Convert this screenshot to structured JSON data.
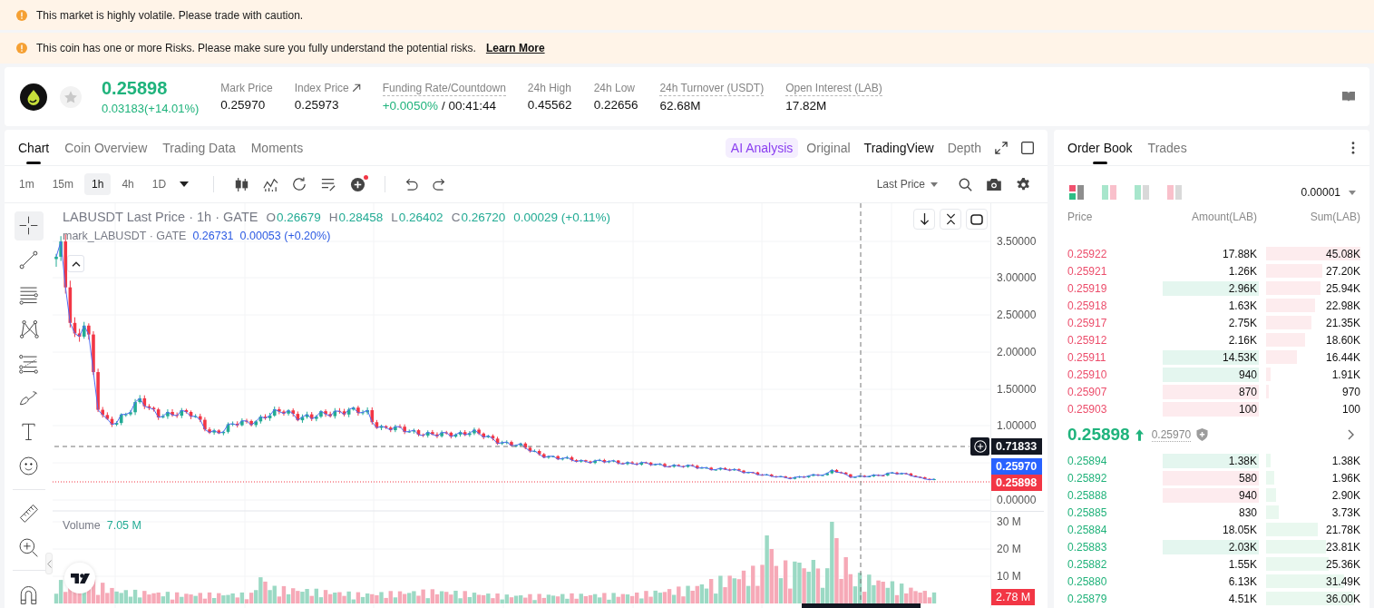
{
  "alerts": [
    {
      "text": "This market is highly volatile. Please trade with caution."
    },
    {
      "text": "This coin has one or more Risks. Please make sure you fully understand the potential risks.",
      "link": "Learn More"
    }
  ],
  "ticker": {
    "price": "0.25898",
    "change": "0.03183(+14.01%)",
    "favorite": false,
    "stats": [
      {
        "kind": "plain",
        "label": "Mark Price",
        "value": "0.25970",
        "dotted": false
      },
      {
        "kind": "link",
        "label": "Index Price",
        "value": "0.25973",
        "dotted": false
      },
      {
        "kind": "funding",
        "label": "Funding Rate/Countdown",
        "value": "+0.0050%",
        "countdown": "/ 00:41:44",
        "dotted": true
      },
      {
        "kind": "plain",
        "label": "24h High",
        "value": "0.45562",
        "dotted": false
      },
      {
        "kind": "plain",
        "label": "24h Low",
        "value": "0.22656",
        "dotted": false
      },
      {
        "kind": "plain",
        "label": "24h Turnover (USDT)",
        "value": "62.68M",
        "dotted": true
      },
      {
        "kind": "plain",
        "label": "Open Interest (LAB)",
        "value": "17.82M",
        "dotted": true
      }
    ]
  },
  "chart_panel": {
    "tabs": [
      {
        "label": "Chart",
        "selected": true
      },
      {
        "label": "Coin Overview",
        "selected": false
      },
      {
        "label": "Trading Data",
        "selected": false
      },
      {
        "label": "Moments",
        "selected": false
      }
    ],
    "ai_button": "AI Analysis",
    "views": [
      {
        "label": "Original",
        "selected": false
      },
      {
        "label": "TradingView",
        "selected": true
      },
      {
        "label": "Depth",
        "selected": false
      }
    ],
    "intervals": [
      {
        "label": "1m",
        "selected": false
      },
      {
        "label": "15m",
        "selected": false
      },
      {
        "label": "1h",
        "selected": true
      },
      {
        "label": "4h",
        "selected": false
      },
      {
        "label": "1D",
        "selected": false
      }
    ],
    "price_source": "Last Price",
    "tools": [
      {
        "selected": true
      },
      {
        "selected": false
      },
      {
        "selected": false
      },
      {
        "selected": false
      },
      {
        "selected": false
      },
      {
        "selected": false
      },
      {
        "selected": false
      },
      {
        "selected": false
      },
      {
        "selected": false
      },
      {
        "selected": false
      },
      {
        "selected": false
      }
    ],
    "legend": {
      "symbol": "LABUSDT Last Price · 1h · GATE",
      "ohlc": [
        {
          "key": "O",
          "value": "0.26679"
        },
        {
          "key": "H",
          "value": "0.28458"
        },
        {
          "key": "L",
          "value": "0.26402"
        },
        {
          "key": "C",
          "value": "0.26720"
        }
      ],
      "change": "0.00029 (+0.11%)",
      "mark_symbol": "mark_LABUSDT · GATE",
      "mark_price": "0.26731",
      "mark_change": "0.00053 (+0.20%)"
    },
    "price_axis": [
      "3.50000",
      "3.00000",
      "2.50000",
      "2.00000",
      "1.50000",
      "1.00000",
      "0.00000"
    ],
    "price_tags": [
      {
        "kind": "crosshair",
        "text": "0.71833"
      },
      {
        "kind": "mark",
        "text": "0.25970"
      },
      {
        "kind": "last",
        "text": "0.25898"
      }
    ],
    "volume": {
      "label": "Volume",
      "value": "7.05 M",
      "axis": [
        "30 M",
        "20 M",
        "10 M"
      ],
      "tag": "2.78 M"
    }
  },
  "order_book": {
    "tabs": [
      {
        "label": "Order Book",
        "selected": true
      },
      {
        "label": "Trades",
        "selected": false
      }
    ],
    "layouts": [
      {
        "selected": true
      },
      {
        "selected": false
      },
      {
        "selected": false
      },
      {
        "selected": false
      }
    ],
    "precision": "0.00001",
    "columns": [
      "Price",
      "Amount(LAB)",
      "Sum(LAB)"
    ],
    "asks": [
      {
        "price": "0.25922",
        "amount": "17.88K",
        "sum": "45.08K",
        "level": 1.0
      },
      {
        "price": "0.25921",
        "amount": "1.26K",
        "sum": "27.20K",
        "level": 0.6
      },
      {
        "price": "0.25919",
        "amount": "2.96K",
        "sum": "25.94K",
        "color": "#e4f6ef",
        "level": 0.58
      },
      {
        "price": "0.25918",
        "amount": "1.63K",
        "sum": "22.98K",
        "level": 0.52
      },
      {
        "price": "0.25917",
        "amount": "2.75K",
        "sum": "21.35K",
        "level": 0.48
      },
      {
        "price": "0.25912",
        "amount": "2.16K",
        "sum": "18.60K",
        "level": 0.41
      },
      {
        "price": "0.25911",
        "amount": "14.53K",
        "sum": "16.44K",
        "color": "#e4f6ef",
        "level": 0.33
      },
      {
        "price": "0.25910",
        "amount": "940",
        "sum": "1.91K",
        "color": "#e4f6ef",
        "level": 0.05
      },
      {
        "price": "0.25907",
        "amount": "870",
        "sum": "970",
        "color": "#fdebee",
        "level": 0.03
      },
      {
        "price": "0.25903",
        "amount": "100",
        "sum": "100",
        "color": "#fdebee"
      }
    ],
    "last_price": "0.25898",
    "rising": true,
    "mark_price": "0.25970",
    "bids": [
      {
        "price": "0.25894",
        "amount": "1.38K",
        "sum": "1.38K",
        "color": "#e4f6ef",
        "level": 0.05
      },
      {
        "price": "0.25892",
        "amount": "580",
        "sum": "1.96K",
        "color": "#fdebee",
        "level": 0.09
      },
      {
        "price": "0.25888",
        "amount": "940",
        "sum": "2.90K",
        "color": "#fdebee",
        "level": 0.11
      },
      {
        "price": "0.25885",
        "amount": "830",
        "sum": "3.73K",
        "level": 0.13
      },
      {
        "price": "0.25884",
        "amount": "18.05K",
        "sum": "21.78K",
        "level": 0.55
      },
      {
        "price": "0.25883",
        "amount": "2.03K",
        "sum": "23.81K",
        "color": "#e4f6ef",
        "level": 0.63
      },
      {
        "price": "0.25882",
        "amount": "1.55K",
        "sum": "25.36K",
        "level": 0.66
      },
      {
        "price": "0.25880",
        "amount": "6.13K",
        "sum": "31.49K",
        "level": 0.83
      },
      {
        "price": "0.25879",
        "amount": "4.51K",
        "sum": "36.00K",
        "level": 0.93
      }
    ]
  }
}
